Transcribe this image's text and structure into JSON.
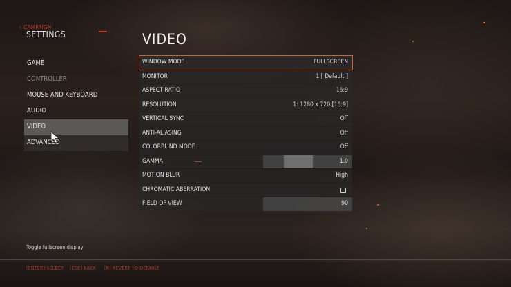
{
  "breadcrumb": {
    "parent": "CAMPAIGN",
    "section": "SETTINGS"
  },
  "page_title": "VIDEO",
  "nav": [
    {
      "label": "GAME",
      "state": "normal"
    },
    {
      "label": "CONTROLLER",
      "state": "disabled"
    },
    {
      "label": "MOUSE AND KEYBOARD",
      "state": "normal"
    },
    {
      "label": "AUDIO",
      "state": "normal"
    },
    {
      "label": "VIDEO",
      "state": "selected"
    },
    {
      "label": "ADVANCED",
      "state": "normal"
    }
  ],
  "settings": [
    {
      "label": "WINDOW MODE",
      "value": "FULLSCREEN"
    },
    {
      "label": "MONITOR",
      "value": "1 [ Default ]"
    },
    {
      "label": "ASPECT RATIO",
      "value": "16:9"
    },
    {
      "label": "RESOLUTION",
      "value": "1: 1280 x 720 [16:9]"
    },
    {
      "label": "VERTICAL SYNC",
      "value": "Off"
    },
    {
      "label": "ANTI-ALIASING",
      "value": "Off"
    },
    {
      "label": "COLORBLIND MODE",
      "value": "Off"
    },
    {
      "label": "GAMMA",
      "value": "1.0",
      "slider_level": 0.35
    },
    {
      "label": "MOTION BLUR",
      "value": "High"
    },
    {
      "label": "CHROMATIC ABERRATION",
      "value": "",
      "checked": false
    },
    {
      "label": "FIELD OF VIEW",
      "value": "90",
      "slider_level": 0.0
    }
  ],
  "description": "Toggle fullscreen display",
  "footer": {
    "select": "[ENTER] SELECT",
    "back": "[ESC] BACK",
    "revert": "[R] REVERT TO DEFAULT"
  },
  "colors": {
    "accent": "#c73a23",
    "highlight_border": "#d2622e"
  }
}
